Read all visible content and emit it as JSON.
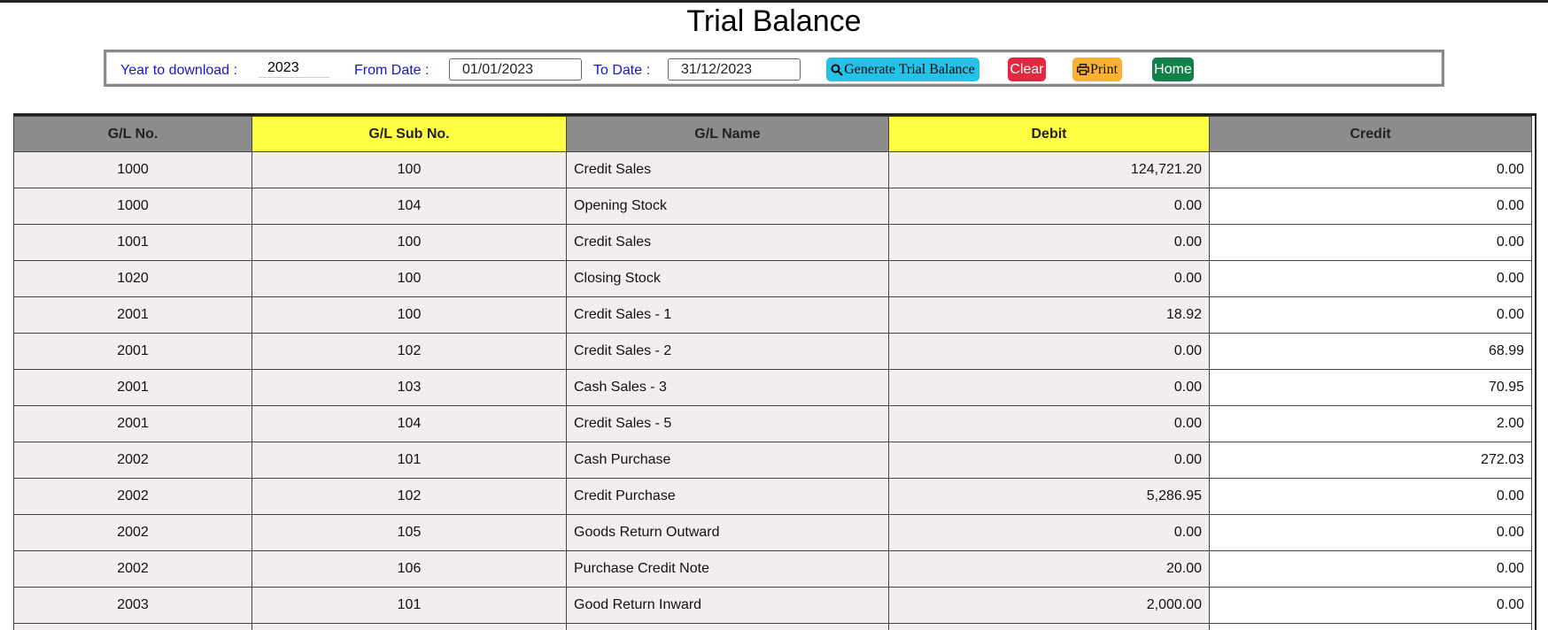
{
  "page": {
    "title": "Trial Balance"
  },
  "toolbar": {
    "year_label": "Year to download :",
    "year_value": "2023",
    "from_label": "From Date :",
    "from_value": "01/01/2023",
    "to_label": "To Date :",
    "to_value": "31/12/2023",
    "generate_label": "Generate Trial Balance",
    "clear_label": "Clear",
    "print_label": "Print",
    "home_label": "Home"
  },
  "icons": {
    "generate": "search-icon",
    "print": "printer-icon"
  },
  "colors": {
    "label_text": "#1616d6",
    "header_gray": "#8c8c8c",
    "header_yellow": "#ffff44",
    "row_bg": "#f3eeee",
    "generate_btn": "#26c1e8",
    "clear_btn": "#e2283e",
    "print_btn": "#fbb233",
    "home_btn": "#118049"
  },
  "table": {
    "headers": [
      "G/L No.",
      "G/L Sub No.",
      "G/L Name",
      "Debit",
      "Credit"
    ],
    "rows": [
      [
        "1000",
        "100",
        "Credit Sales",
        "124,721.20",
        "0.00"
      ],
      [
        "1000",
        "104",
        "Opening Stock",
        "0.00",
        "0.00"
      ],
      [
        "1001",
        "100",
        "Credit Sales",
        "0.00",
        "0.00"
      ],
      [
        "1020",
        "100",
        "Closing Stock",
        "0.00",
        "0.00"
      ],
      [
        "2001",
        "100",
        "Credit Sales - 1",
        "18.92",
        "0.00"
      ],
      [
        "2001",
        "102",
        "Credit Sales - 2",
        "0.00",
        "68.99"
      ],
      [
        "2001",
        "103",
        "Cash Sales - 3",
        "0.00",
        "70.95"
      ],
      [
        "2001",
        "104",
        "Credit Sales - 5",
        "0.00",
        "2.00"
      ],
      [
        "2002",
        "101",
        "Cash Purchase",
        "0.00",
        "272.03"
      ],
      [
        "2002",
        "102",
        "Credit Purchase",
        "5,286.95",
        "0.00"
      ],
      [
        "2002",
        "105",
        "Goods Return Outward",
        "0.00",
        "0.00"
      ],
      [
        "2002",
        "106",
        "Purchase Credit Note",
        "20.00",
        "0.00"
      ],
      [
        "2003",
        "101",
        "Good Return Inward",
        "2,000.00",
        "0.00"
      ],
      [
        "",
        "",
        "",
        "",
        ""
      ]
    ]
  }
}
